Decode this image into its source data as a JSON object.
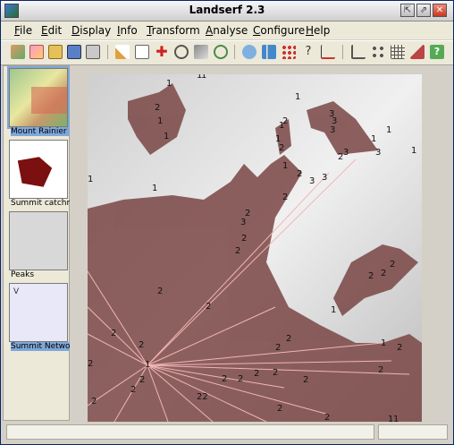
{
  "window": {
    "title": "Landserf 2.3",
    "buttons": {
      "minimize": "⇱",
      "maximize": "⇗",
      "close": "✕"
    }
  },
  "menu": [
    "File",
    "Edit",
    "Display",
    "Info",
    "Transform",
    "Analyse",
    "Configure",
    "Help"
  ],
  "toolbar": {
    "icons": [
      "raster-map-icon",
      "vector-map-icon",
      "open-folder-icon",
      "save-icon",
      "print-icon",
      "edit-pencil-icon",
      "edit-text-icon",
      "crosshair-icon",
      "zoom-icon",
      "pan-icon",
      "rotate-icon",
      "comment-icon",
      "bar-chart-icon",
      "scatter-plot-icon",
      "query-icon",
      "line-chart-icon",
      "angle-icon",
      "network-icon",
      "grid-icon",
      "terrain-icon",
      "help-icon"
    ]
  },
  "sidebar": {
    "items": [
      {
        "label": "Mount Rainier"
      },
      {
        "label": "Summit catchment"
      },
      {
        "label": "Peaks"
      },
      {
        "label": "Summit Network"
      }
    ]
  },
  "map": {
    "peak_labels": [
      "1",
      "1",
      "1",
      "1",
      "2",
      "1",
      "3",
      "3",
      "3",
      "1",
      "1",
      "3",
      "1",
      "1",
      "1",
      "3",
      "2",
      "2",
      "2",
      "1",
      "1",
      "2",
      "3",
      "3",
      "3",
      "2",
      "2",
      "2",
      "2",
      "1",
      "1",
      "2",
      "2",
      "1",
      "2",
      "2",
      "2",
      "2",
      "2",
      "2",
      "2",
      "2",
      "1",
      "2",
      "2",
      "2",
      "2",
      "22",
      "2",
      "2",
      "2",
      "2",
      "1",
      "2",
      "2",
      "2",
      "2",
      "1",
      "1"
    ]
  },
  "status": {
    "left": "",
    "right": ""
  }
}
